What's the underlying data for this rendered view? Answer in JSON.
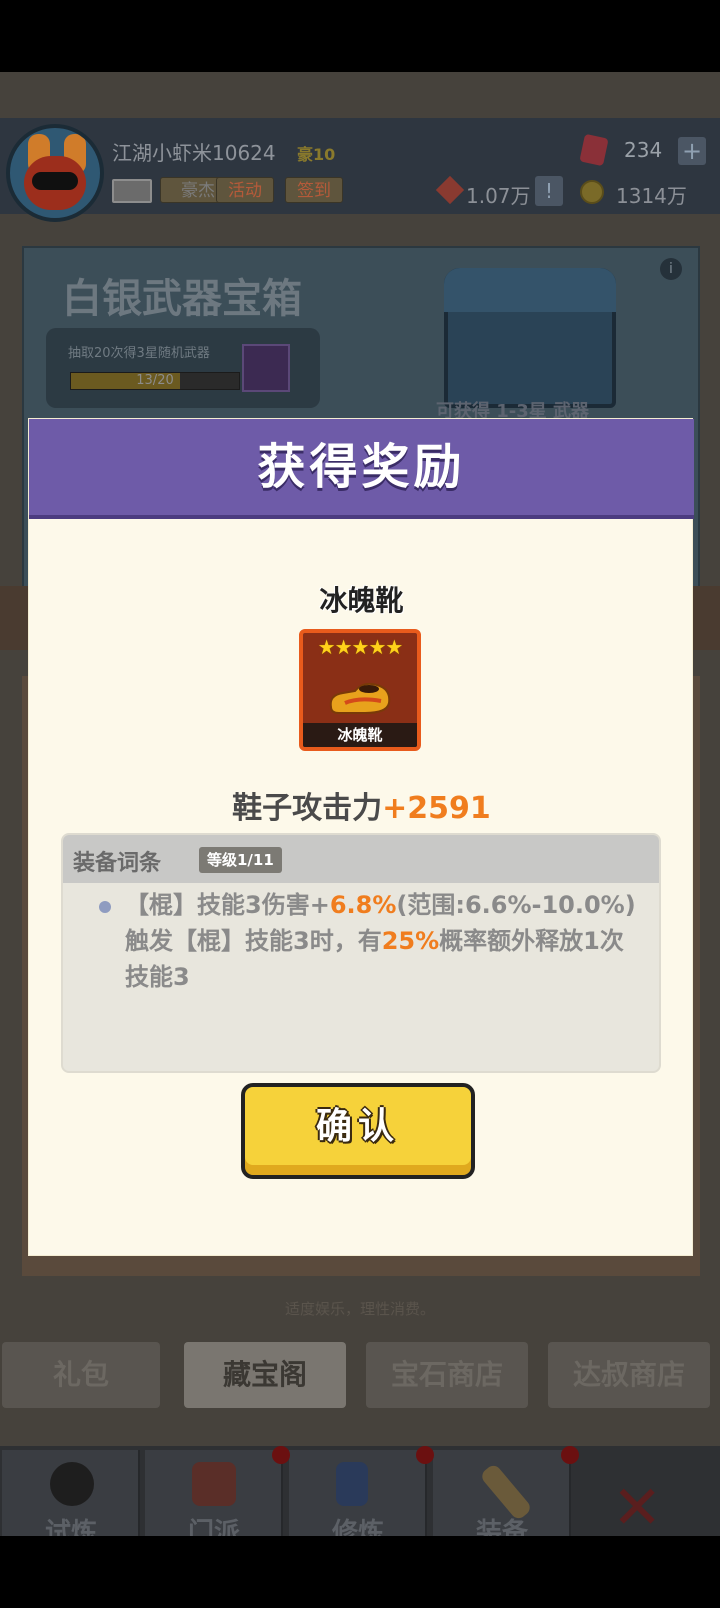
{
  "header": {
    "username": "江湖小虾米10624",
    "vip": "豪10",
    "rank_label": "豪杰",
    "activity_label": "活动",
    "checkin_label": "签到",
    "gems": "234",
    "plus_symbol": "+",
    "power": "1.07万",
    "warn_symbol": "!",
    "coins": "1314万"
  },
  "chest": {
    "title": "白银武器宝箱",
    "progress_text": "抽取20次得3星随机武器",
    "progress_value": "13/20",
    "progress_fraction": 0.65,
    "subtitle": "可获得 1-3星 武器",
    "info_symbol": "i"
  },
  "slogan": "适度娱乐，理性消费。",
  "shop_tabs": [
    {
      "label": "礼包",
      "active": false
    },
    {
      "label": "藏宝阁",
      "active": true
    },
    {
      "label": "宝石商店",
      "active": false
    },
    {
      "label": "达叔商店",
      "active": false
    }
  ],
  "nav": [
    {
      "label": "试炼"
    },
    {
      "label": "门派"
    },
    {
      "label": "修炼"
    },
    {
      "label": "装备"
    }
  ],
  "modal": {
    "title": "获得奖励",
    "item_name": "冰魄靴",
    "item_stars": "★★★★★",
    "item_card_label": "冰魄靴",
    "attack_label": "鞋子攻击力",
    "attack_value": "+2591",
    "affix_title": "装备词条",
    "affix_level": "等级1/11",
    "affix_prefix": "【棍】技能3伤害+",
    "affix_value": "6.8%",
    "affix_range": "(范围:6.6%-10.0%)",
    "affix_trigger_prefix": "触发【棍】技能3时，有",
    "affix_chance": "25%",
    "affix_trigger_suffix": "概率额外释放1次技能3",
    "confirm_label": "确认"
  },
  "colors": {
    "modal_header": "#6e5ba8",
    "highlight": "#f07d1e",
    "confirm_button": "#f6d23a"
  }
}
